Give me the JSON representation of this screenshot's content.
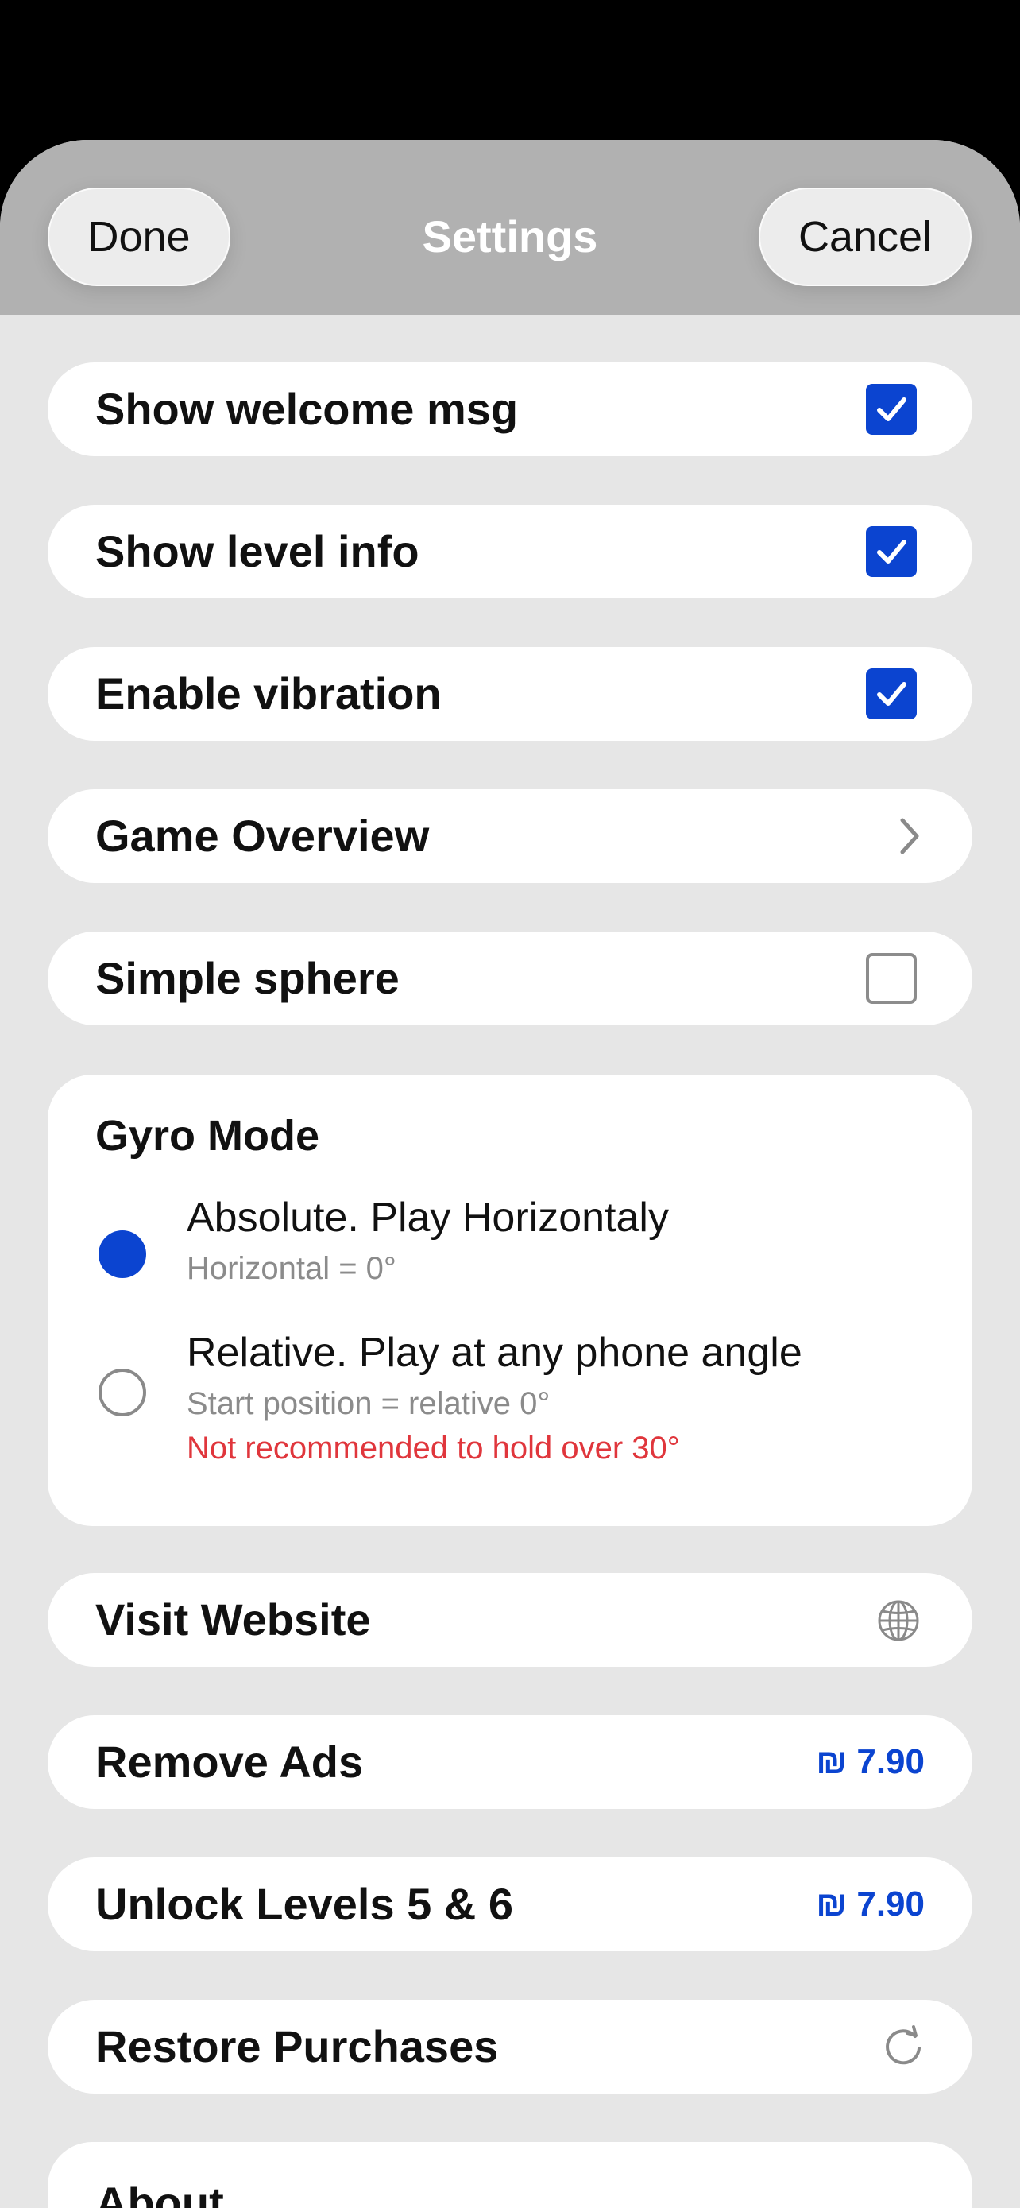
{
  "nav": {
    "title": "Settings",
    "done_label": "Done",
    "cancel_label": "Cancel"
  },
  "rows": {
    "welcome": {
      "label": "Show welcome msg",
      "checked": true
    },
    "level_info": {
      "label": "Show level info",
      "checked": true
    },
    "vibration": {
      "label": "Enable vibration",
      "checked": true
    },
    "overview": {
      "label": "Game Overview",
      "icon": "chevron-right-icon"
    },
    "simple_sphere": {
      "label": "Simple sphere",
      "checked": false
    }
  },
  "gyro": {
    "title": "Gyro Mode",
    "options": [
      {
        "title": "Absolute. Play Horizontaly",
        "sub": "Horizontal = 0°",
        "selected": true
      },
      {
        "title": "Relative. Play at any phone angle",
        "sub": "Start position = relative 0°",
        "warning": "Not recommended to hold over 30°",
        "selected": false
      }
    ]
  },
  "website": {
    "label": "Visit Website",
    "icon": "globe-icon"
  },
  "remove_ads": {
    "label": "Remove Ads",
    "price": "₪ 7.90"
  },
  "unlock": {
    "label": "Unlock Levels 5 & 6",
    "price": "₪ 7.90"
  },
  "restore": {
    "label": "Restore Purchases",
    "icon": "refresh-icon"
  },
  "about": {
    "label": "About"
  },
  "colors": {
    "accent": "#0b44d0",
    "warning": "#e0363c",
    "navbar": "#b1b1b1",
    "background": "#e6e6e6"
  }
}
